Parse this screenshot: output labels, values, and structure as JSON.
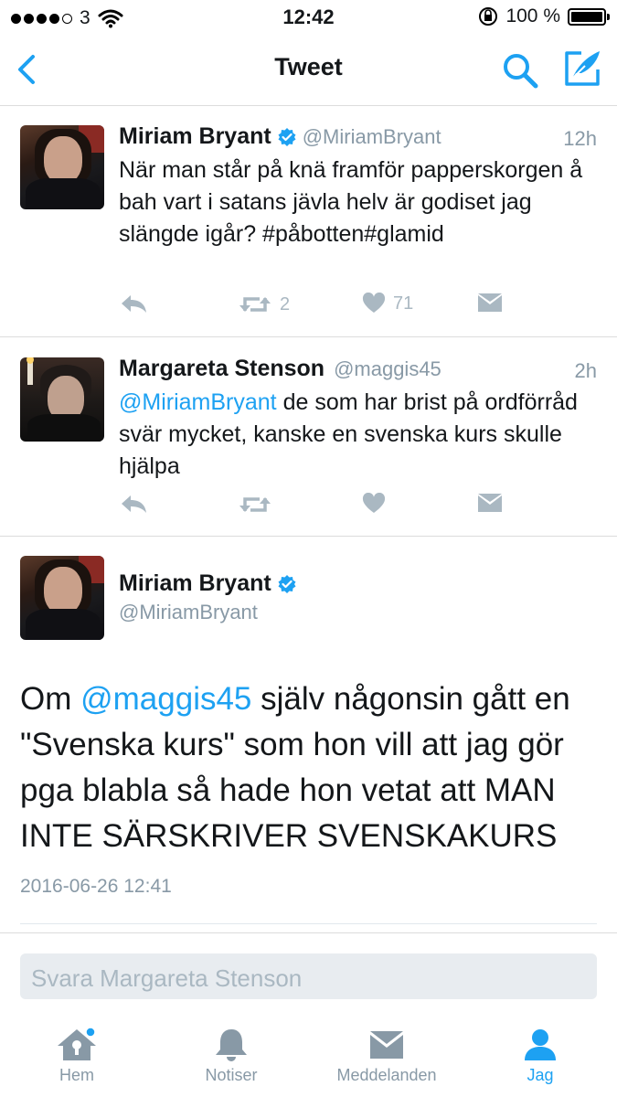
{
  "status_bar": {
    "carrier": "3",
    "time": "12:42",
    "battery": "100 %"
  },
  "navbar": {
    "title": "Tweet"
  },
  "tweets": [
    {
      "name": "Miriam Bryant",
      "handle": "@MiriamBryant",
      "time": "12h",
      "text": "När man står på knä framför papperskorgen å bah vart i satans jävla helv är godiset jag slängde igår? #påbotten#glamid",
      "retweets": "2",
      "likes": "71"
    },
    {
      "name": "Margareta Stenson",
      "handle": "@maggis45",
      "time": "2h",
      "mention": "@MiriamBryant",
      "text": " de som har brist på ordförråd svär mycket, kanske en svenska kurs skulle hjälpa"
    }
  ],
  "focused_tweet": {
    "name": "Miriam Bryant",
    "handle": "@MiriamBryant",
    "text_before": "Om ",
    "mention": "@maggis45",
    "text_after": " själv någonsin gått en \"Svenska kurs\" som hon vill att jag gör pga blabla så hade hon vetat att MAN INTE SÄRSKRIVER SVENSKAKURS",
    "timestamp": "2016-06-26 12:41"
  },
  "reply": {
    "placeholder": "Svara Margareta Stenson"
  },
  "tabbar": {
    "items": [
      {
        "label": "Hem",
        "icon": "home-icon"
      },
      {
        "label": "Notiser",
        "icon": "bell-icon"
      },
      {
        "label": "Meddelanden",
        "icon": "envelope-icon"
      },
      {
        "label": "Jag",
        "icon": "person-icon"
      }
    ]
  },
  "colors": {
    "accent": "#1da1f2",
    "muted": "#8899a6",
    "icon_gray": "#aab8c2"
  }
}
